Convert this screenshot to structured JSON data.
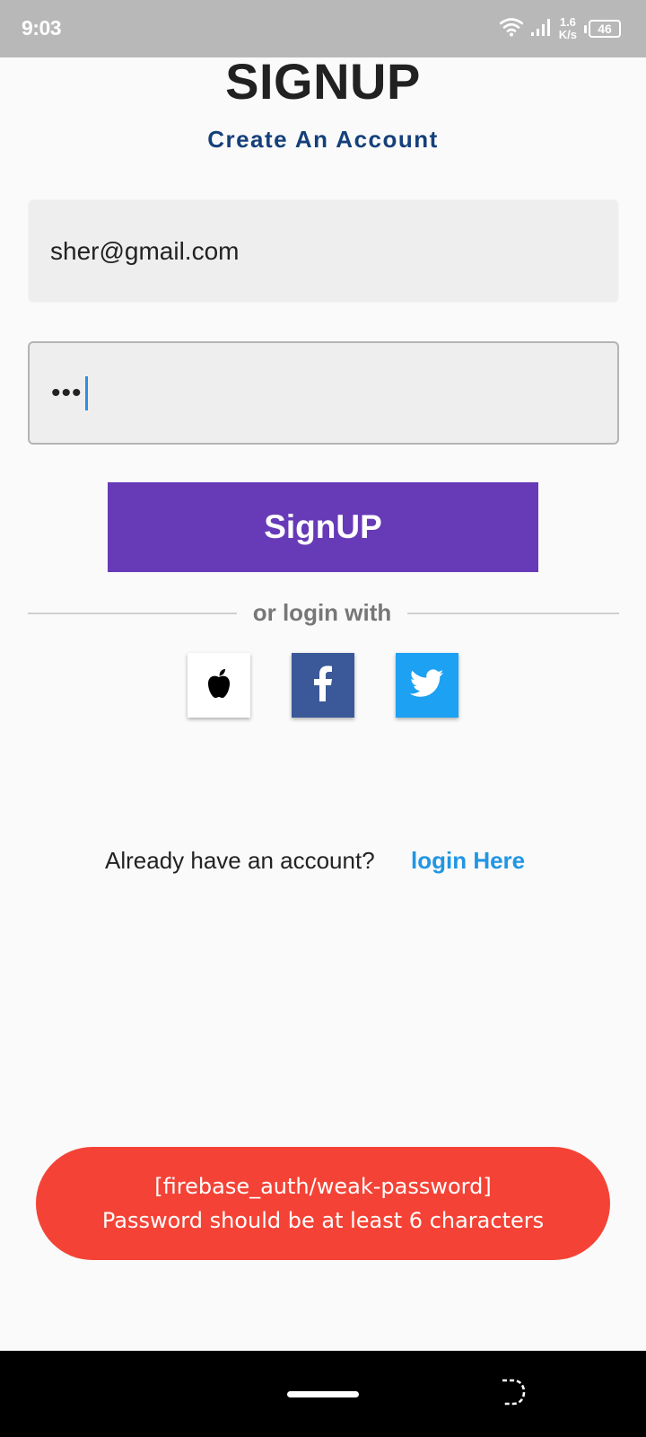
{
  "status_bar": {
    "time": "9:03",
    "net_speed_value": "1.6",
    "net_speed_unit": "K/s",
    "battery": "46",
    "icons": [
      "wifi-icon",
      "signal-icon",
      "battery-icon"
    ]
  },
  "header": {
    "title": "SIGNUP",
    "subtitle": "Create An Account"
  },
  "form": {
    "email_value": "sher@gmail.com",
    "password_masked": "•••",
    "submit_label": "SignUP"
  },
  "divider": {
    "label": "or login with"
  },
  "social": [
    {
      "name": "apple",
      "icon": "apple-icon",
      "color": "#ffffff"
    },
    {
      "name": "facebook",
      "icon": "facebook-icon",
      "color": "#3b5998"
    },
    {
      "name": "twitter",
      "icon": "twitter-icon",
      "color": "#1da1f2"
    }
  ],
  "footer": {
    "prompt": "Already have an account?",
    "link": "login Here"
  },
  "toast": {
    "line1": "[firebase_auth/weak-password]",
    "line2": "Password should be at least 6 characters"
  },
  "colors": {
    "primary": "#673ab7",
    "subtitle": "#15407a",
    "link": "#2196e3",
    "error": "#f44336"
  }
}
